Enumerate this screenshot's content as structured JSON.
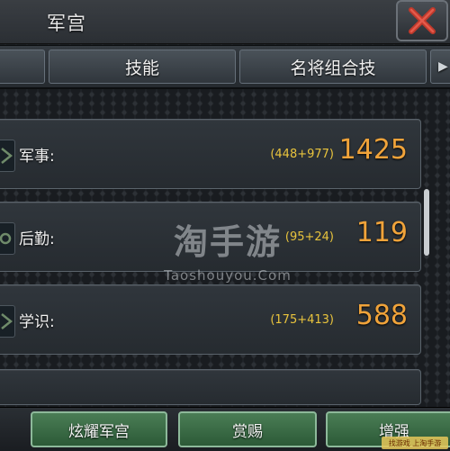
{
  "window": {
    "title": "军宫"
  },
  "tabs": [
    {
      "label": ""
    },
    {
      "label": "技能"
    },
    {
      "label": "名将组合技"
    },
    {
      "label": "▶"
    }
  ],
  "stats": [
    {
      "name": "military",
      "label": "军事:",
      "breakdown": "(448+977)",
      "total": "1425"
    },
    {
      "name": "logistics",
      "label": "后勤:",
      "breakdown": "(95+24)",
      "total": "119"
    },
    {
      "name": "learning",
      "label": "学识:",
      "breakdown": "(175+413)",
      "total": "588"
    }
  ],
  "watermark": {
    "cn": "淘手游",
    "en": "Taoshouyou.Com"
  },
  "buttons": {
    "show_off": "炫耀军宫",
    "reward": "赏赐",
    "enhance": "增强"
  },
  "corner_badge": "找游戏 上淘手游",
  "colors": {
    "total": "#f0a33a",
    "breakdown": "#e9c43d",
    "button_green": "#2c5a37",
    "close_x": "#c0392b"
  },
  "icons": {
    "close": "close-icon",
    "row": "stat-emblem-icon",
    "arrow": "chevron-right-icon"
  }
}
